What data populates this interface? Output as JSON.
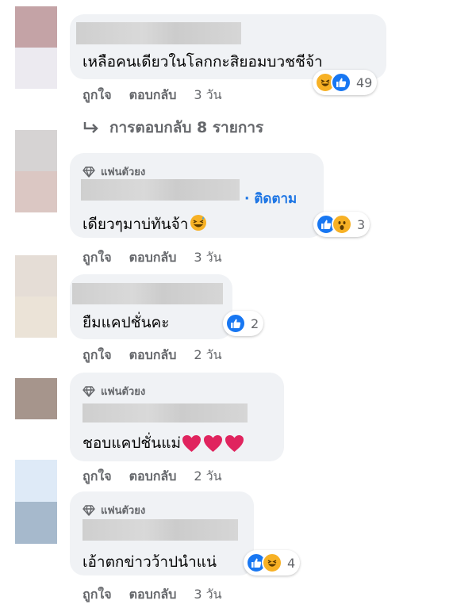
{
  "comments": [
    {
      "text": "เหลือคนเดียวในโลกกะสิยอมบวชชีจ้า",
      "reaction_count": "49",
      "reaction_icons": [
        "haha-icon",
        "like-icon"
      ],
      "actions": {
        "like": "ถูกใจ",
        "reply": "ตอบกลับ",
        "time": "3 วัน"
      },
      "more_replies": "การตอบกลับ 8 รายการ"
    },
    {
      "badge": "แฟนตัวยง",
      "follow": "· ติดตาม",
      "text": "เดียวๆมาบ่ทันจ้า",
      "reaction_count": "3",
      "reaction_icons": [
        "like-icon",
        "wow-icon"
      ],
      "actions": {
        "like": "ถูกใจ",
        "reply": "ตอบกลับ",
        "time": "3 วัน"
      }
    },
    {
      "text": "ยืมแคปชั่นคะ",
      "reaction_count": "2",
      "reaction_icons": [
        "like-icon"
      ],
      "actions": {
        "like": "ถูกใจ",
        "reply": "ตอบกลับ",
        "time": "2 วัน"
      }
    },
    {
      "badge": "แฟนตัวยง",
      "text": "ชอบแคปชั่นแม่",
      "actions": {
        "like": "ถูกใจ",
        "reply": "ตอบกลับ",
        "time": "2 วัน"
      }
    },
    {
      "badge": "แฟนตัวยง",
      "text": "เอ้าตกข่าวว้าปนำแน่",
      "reaction_count": "4",
      "reaction_icons": [
        "like-icon",
        "haha-icon"
      ],
      "actions": {
        "like": "ถูกใจ",
        "reply": "ตอบกลับ",
        "time": "3 วัน"
      }
    }
  ],
  "colors": {
    "bubble": "#f0f2f5",
    "secondary_text": "#65676b",
    "link_blue": "#1b74e4",
    "like_blue": "#1877f2",
    "emoji_yellow": "#f7b125",
    "heart_red": "#e0245e"
  }
}
